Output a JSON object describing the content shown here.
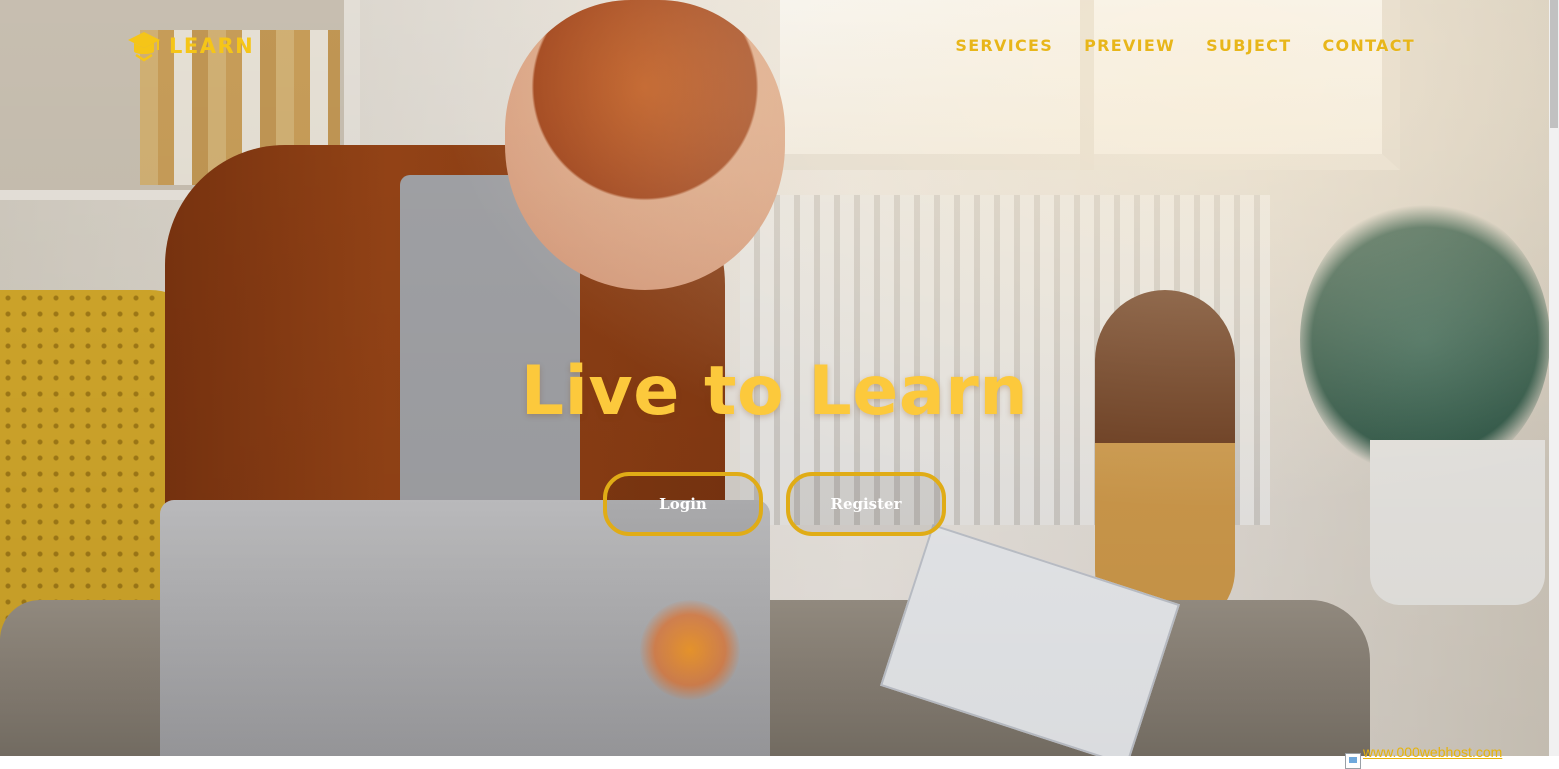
{
  "brand": {
    "name": "LEARN",
    "icon": "graduation-cap-icon",
    "color": "#f5c518"
  },
  "nav": {
    "items": [
      {
        "label": "SERVICES"
      },
      {
        "label": "PREVIEW"
      },
      {
        "label": "SUBJECT"
      },
      {
        "label": "CONTACT"
      }
    ],
    "color": "#e8b61a"
  },
  "hero": {
    "headline": "Live to Learn",
    "headline_color": "#fcc93c",
    "background_image": "student-studying-with-laptop-photo"
  },
  "buttons": {
    "login": "Login",
    "register": "Register",
    "border_color": "#e0ac16"
  },
  "footer_badge": {
    "text": "www.000webhost.com",
    "icon": "broken-image-icon"
  }
}
